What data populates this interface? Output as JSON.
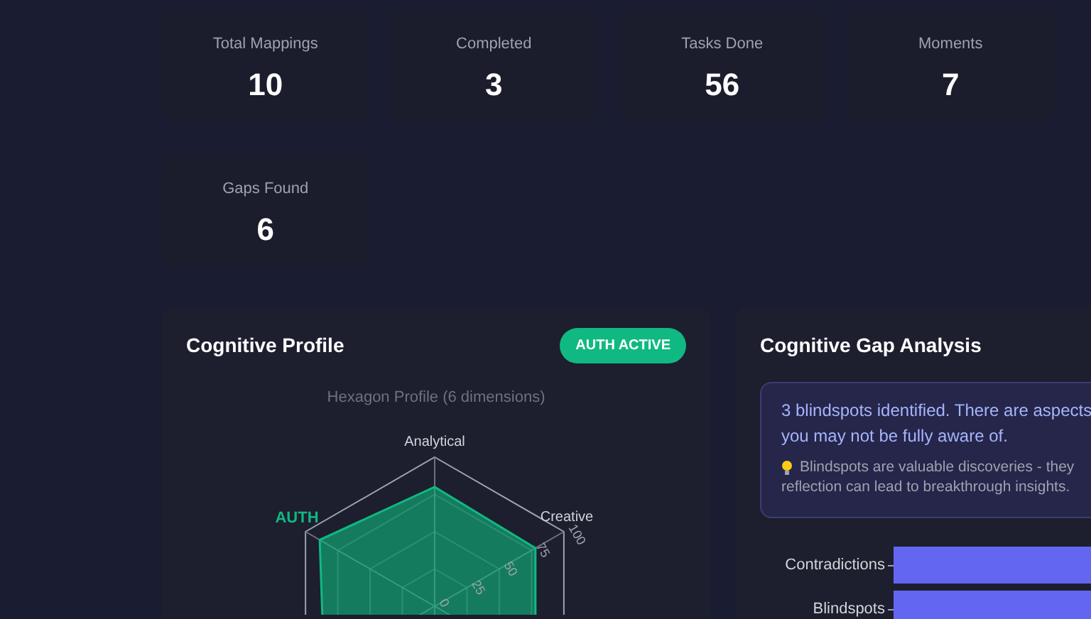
{
  "stats": [
    {
      "label": "Total Mappings",
      "value": "10"
    },
    {
      "label": "Completed",
      "value": "3"
    },
    {
      "label": "Tasks Done",
      "value": "56"
    },
    {
      "label": "Moments",
      "value": "7"
    },
    {
      "label": "Gaps Found",
      "value": "6"
    }
  ],
  "profile": {
    "title": "Cognitive Profile",
    "badge": "AUTH ACTIVE",
    "subtitle": "Hexagon Profile (6 dimensions)",
    "radar": {
      "axes": [
        {
          "label": "Analytical",
          "highlighted": false
        },
        {
          "label": "Creative",
          "highlighted": false
        },
        {
          "label": "AUTH",
          "highlighted": true
        }
      ],
      "scale_labels": [
        "0",
        "25",
        "50",
        "75",
        "100"
      ]
    }
  },
  "gap_analysis": {
    "title": "Cognitive Gap Analysis",
    "message_lines": [
      "3 blindspots identified. There are aspects",
      "you may not be fully aware of."
    ],
    "tip_lines": [
      "Blindspots are valuable discoveries - they",
      "reflection can lead to breakthrough insights."
    ],
    "bar_chart": {
      "categories": [
        "Contradictions",
        "Blindspots"
      ]
    }
  }
}
